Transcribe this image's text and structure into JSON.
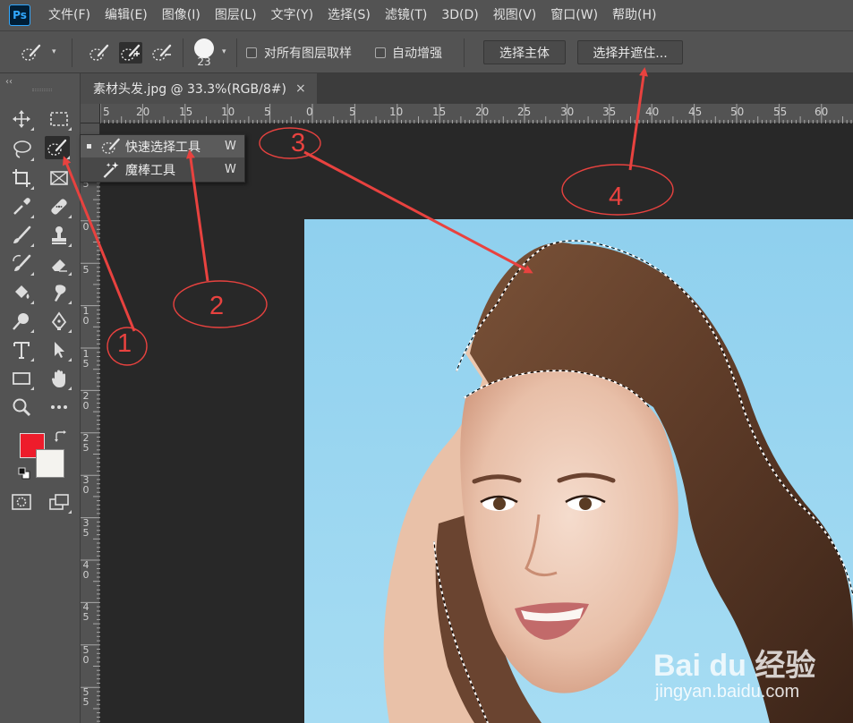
{
  "app": {
    "logo": "Ps"
  },
  "menu": [
    "文件(F)",
    "编辑(E)",
    "图像(I)",
    "图层(L)",
    "文字(Y)",
    "选择(S)",
    "滤镜(T)",
    "3D(D)",
    "视图(V)",
    "窗口(W)",
    "帮助(H)"
  ],
  "options": {
    "brush_size": "23",
    "sample_all_layers": "对所有图层取样",
    "auto_enhance": "自动增强",
    "select_subject": "选择主体",
    "select_and_mask": "选择并遮住..."
  },
  "tabs": [
    {
      "title": "素材头发.jpg @ 33.3%(RGB/8#)",
      "close": "×"
    }
  ],
  "ruler": {
    "top": [
      "5",
      "20",
      "15",
      "10",
      "5",
      "0",
      "5",
      "10",
      "15",
      "20",
      "25",
      "30",
      "35",
      "40",
      "45",
      "50",
      "55",
      "60"
    ],
    "left": [
      "5",
      "0",
      "5",
      "1 0",
      "1 5",
      "2 0",
      "2 5",
      "3 0",
      "3 5",
      "4 0",
      "4 5",
      "5 0",
      "5 5"
    ]
  },
  "flyout": {
    "items": [
      {
        "label": "快速选择工具",
        "shortcut": "W"
      },
      {
        "label": "魔棒工具",
        "shortcut": "W"
      }
    ]
  },
  "colors": {
    "foreground": "#ee1c2b",
    "background": "#f4f3ef",
    "annotation": "#e8423f"
  },
  "icons": [
    "move-icon",
    "marquee-icon",
    "lasso-icon",
    "quick-selection-icon",
    "crop-icon",
    "frame-icon",
    "eyedropper-icon",
    "healing-icon",
    "brush-icon",
    "stamp-icon",
    "history-brush-icon",
    "eraser-icon",
    "paint-bucket-icon",
    "smudge-icon",
    "dodge-icon",
    "pen-icon",
    "type-icon",
    "path-select-icon",
    "rectangle-icon",
    "hand-icon",
    "zoom-icon",
    "more-icon",
    "quick-mask-icon",
    "screen-mode-icon"
  ],
  "annotations": [
    "1",
    "2",
    "3",
    "4"
  ],
  "watermark": {
    "brand": "Bai du 经验",
    "url": "jingyan.baidu.com"
  }
}
